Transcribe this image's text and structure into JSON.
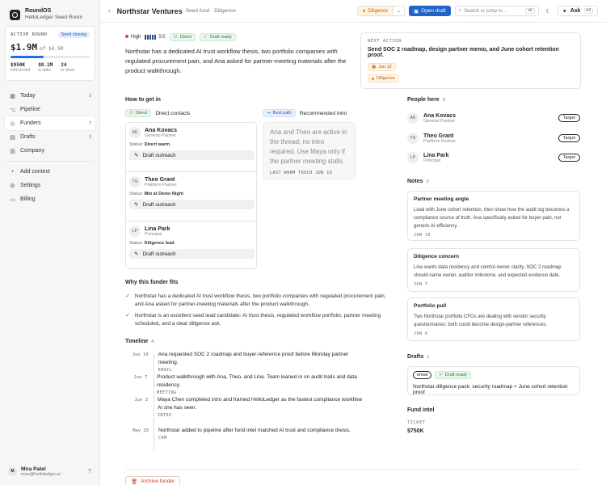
{
  "app": {
    "name": "RoundOS",
    "workspace": "HelloLedger Seed Room"
  },
  "round": {
    "label": "ACTIVE ROUND",
    "badge": "Seed closing",
    "raised": "$1.9M",
    "target": "of $4.5M",
    "progress_fraction": 0.42,
    "stats": [
      {
        "value": "$950K",
        "label": "soft-circled"
      },
      {
        "value": "$8.1M",
        "label": "in talks"
      },
      {
        "value": "24",
        "label": "to close"
      }
    ]
  },
  "nav": {
    "items": [
      {
        "label": "Today",
        "count": "3",
        "icon": "calendar-icon"
      },
      {
        "label": "Pipeline",
        "count": "",
        "icon": "pipeline-icon"
      },
      {
        "label": "Funders",
        "count": "7",
        "icon": "funders-icon",
        "active": true
      },
      {
        "label": "Drafts",
        "count": "3",
        "icon": "drafts-icon"
      },
      {
        "label": "Company",
        "count": "",
        "icon": "company-icon"
      }
    ],
    "secondary": [
      {
        "label": "Add context",
        "icon": "plus-icon"
      },
      {
        "label": "Settings",
        "icon": "gear-icon"
      },
      {
        "label": "Billing",
        "icon": "card-icon"
      }
    ]
  },
  "user": {
    "initials": "M",
    "name": "Mira Patel",
    "email": "mira@helloledger.ai"
  },
  "topbar": {
    "title": "Northstar Ventures",
    "subtitle": "Seed fund · Diligence",
    "stage": "Diligence",
    "open_draft": "Open draft",
    "search_placeholder": "Search or jump to…",
    "search_kbd": "⌘K",
    "ask": "Ask",
    "ask_kbd": "⌘J"
  },
  "funder": {
    "priority": "High",
    "fit_score": "5/5",
    "fit_level": 5,
    "route": "Direct",
    "draft_state": "Draft ready",
    "summary": "Northstar has a dedicated AI trust workflow thesis, two portfolio companies with regulated procurement pain, and Ana asked for partner-meeting materials after the product walkthrough."
  },
  "next_action": {
    "label": "NEXT ACTION",
    "title": "Send SOC 2 roadmap, design partner memo, and June cohort retention proof.",
    "date": "Jun 12",
    "stage": "Diligence"
  },
  "how_to": {
    "heading": "How to get in",
    "direct_chip": "Direct",
    "direct_label": "Direct contacts",
    "best_chip": "Best path",
    "best_label": "Recommended intro",
    "contacts": [
      {
        "initials": "AK",
        "name": "Ana Kovacs",
        "role": "General Partner",
        "status_label": "Status:",
        "status": "Direct warm",
        "action": "Draft outreach"
      },
      {
        "initials": "TG",
        "name": "Theo Grant",
        "role": "Platform Partner",
        "status_label": "Status:",
        "status": "Met at Demo Night",
        "action": "Draft outreach"
      },
      {
        "initials": "LP",
        "name": "Lina Park",
        "role": "Principal",
        "status_label": "Status:",
        "status": "Diligence lead",
        "action": "Draft outreach"
      }
    ],
    "intro_text": "Ana and Theo are active in the thread; no intro required. Use Maya only if the partner meeting stalls.",
    "intro_meta": "LAST WARM TOUCH JUN 10"
  },
  "why": {
    "heading": "Why this funder fits",
    "items": [
      "Northstar has a dedicated AI trust workflow thesis, two portfolio companies with regulated procurement pain, and Ana asked for partner-meeting materials after the product walkthrough.",
      "Northstar is an excellent seed lead candidate: AI trust thesis, regulated workflow portfolio, partner meeting scheduled, and a clear diligence ask."
    ]
  },
  "timeline": {
    "heading": "Timeline",
    "count": "4",
    "items": [
      {
        "date": "Jun 10",
        "text": "Ana requested SOC 2 roadmap and buyer-reference proof before Monday partner meeting.",
        "tag": "EMAIL"
      },
      {
        "date": "Jun 7",
        "text": "Product walkthrough with Ana, Theo, and Lina. Team leaned in on audit trails and data residency.",
        "tag": "MEETING"
      },
      {
        "date": "Jun 3",
        "text": "Maya Chen completed intro and framed HelloLedger as the fastest compliance workflow AI she has seen.",
        "tag": "INTRO"
      },
      {
        "date": "May 29",
        "text": "Northstar added to pipeline after fund intel matched AI trust and compliance thesis.",
        "tag": "CRM"
      }
    ]
  },
  "archive_label": "Archive funder",
  "people": {
    "heading": "People here",
    "count": "3",
    "items": [
      {
        "initials": "AK",
        "name": "Ana Kovacs",
        "role": "General Partner",
        "tag": "Target"
      },
      {
        "initials": "TG",
        "name": "Theo Grant",
        "role": "Platform Partner",
        "tag": "Target"
      },
      {
        "initials": "LP",
        "name": "Lina Park",
        "role": "Principal",
        "tag": "Target"
      }
    ]
  },
  "notes": {
    "heading": "Notes",
    "count": "3",
    "items": [
      {
        "title": "Partner meeting angle",
        "text": "Lead with June cohort retention, then show how the audit log becomes a compliance source of truth. Ana specifically asked for buyer pain, not generic AI efficiency.",
        "date": "JUN 10"
      },
      {
        "title": "Diligence concern",
        "text": "Lina wants data residency and control-owner clarity. SOC 2 roadmap should name owner, auditor milestone, and expected evidence date.",
        "date": "JUN 7"
      },
      {
        "title": "Portfolio pull",
        "text": "Two Northstar portfolio CFOs are dealing with vendor security questionnaires; both could become design-partner references.",
        "date": "JUN 6"
      }
    ]
  },
  "drafts": {
    "heading": "Drafts",
    "count": "1",
    "channel": "email",
    "state": "Draft ready",
    "title": "Northstar diligence pack: security roadmap + June cohort retention proof"
  },
  "fund_intel": {
    "heading": "Fund intel",
    "ticket_label": "TICKET",
    "ticket_value": "$750K"
  },
  "colors": {
    "accent": "#2164c9",
    "green": "#2c7a3a",
    "orange": "#b35c12",
    "danger": "#c23b30"
  }
}
